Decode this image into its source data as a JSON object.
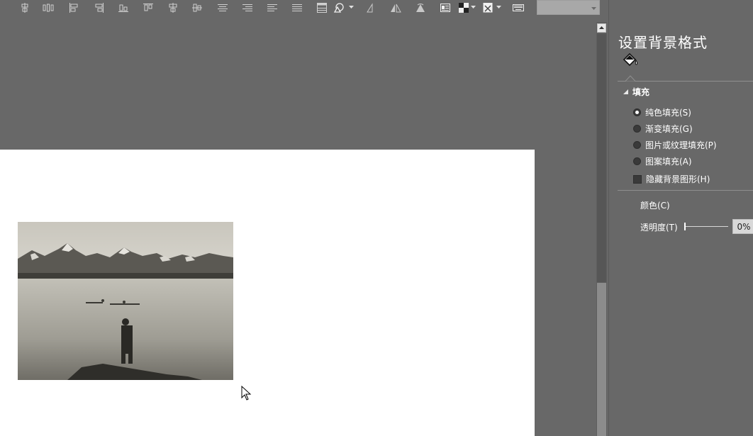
{
  "toolbar": {
    "icons": [
      "align-top-icon",
      "distribute-vertical-icon",
      "align-left-icon",
      "align-right-icon",
      "align-bottom-icon",
      "align-top-edge-icon",
      "align-center-vertical-icon",
      "align-middle-icon",
      "text-center-icon",
      "text-right-icon",
      "text-left-icon",
      "text-justify-icon",
      "table-icon",
      "shape-icon",
      "flip-left-icon",
      "flip-horizontal-icon",
      "rotate-icon",
      "textbox-icon",
      "fill-color-icon",
      "crop-icon",
      "keyboard-icon"
    ],
    "font_dropdown_value": ""
  },
  "panel": {
    "title": "设置背景格式",
    "section_fill": "填充",
    "options": [
      {
        "label": "纯色填充(S)",
        "type": "radio",
        "selected": true
      },
      {
        "label": "渐变填充(G)",
        "type": "radio",
        "selected": false
      },
      {
        "label": "图片或纹理填充(P)",
        "type": "radio",
        "selected": false
      },
      {
        "label": "图案填充(A)",
        "type": "radio",
        "selected": false
      },
      {
        "label": "隐藏背景图形(H)",
        "type": "checkbox",
        "selected": false
      }
    ],
    "color_label": "颜色(C)",
    "transparency_label": "透明度(T)",
    "transparency_value": "0%",
    "transparency_fraction": 0
  },
  "slide": {
    "image_description_icon": "landscape-photo",
    "background_color": "#ffffff"
  },
  "colors": {
    "workspace": "#686868",
    "panel": "#686868",
    "slide": "#ffffff"
  }
}
